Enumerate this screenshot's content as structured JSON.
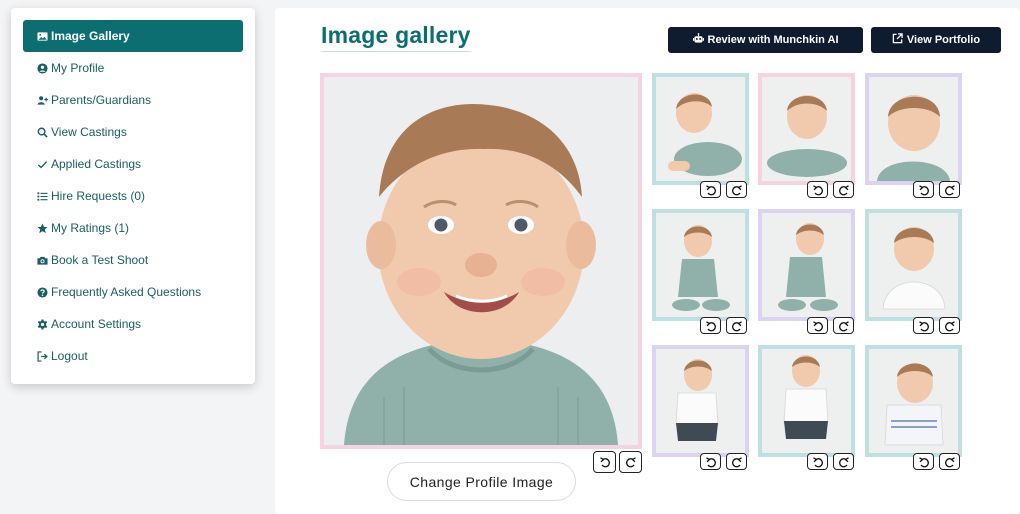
{
  "sidebar": {
    "items": [
      {
        "label": "Image Gallery",
        "icon": "image-icon",
        "active": true
      },
      {
        "label": "My Profile",
        "icon": "user-circle-icon"
      },
      {
        "label": "Parents/Guardians",
        "icon": "user-plus-icon"
      },
      {
        "label": "View Castings",
        "icon": "search-icon"
      },
      {
        "label": "Applied Castings",
        "icon": "check-icon"
      },
      {
        "label": "Hire Requests (0)",
        "icon": "list-icon"
      },
      {
        "label": "My Ratings (1)",
        "icon": "star-icon"
      },
      {
        "label": "Book a Test Shoot",
        "icon": "camera-icon"
      },
      {
        "label": "Frequently Asked Questions",
        "icon": "question-circle-icon"
      },
      {
        "label": "Account Settings",
        "icon": "gear-icon"
      },
      {
        "label": "Logout",
        "icon": "logout-icon"
      }
    ]
  },
  "main": {
    "title": "Image gallery",
    "review_button": "Review with Munchkin AI",
    "portfolio_button": "View Portfolio",
    "change_profile_button": "Change Profile Image"
  },
  "colors": {
    "primary": "#0d6e72",
    "dark_button": "#0f1b2e",
    "frame_teal": "#bfe0e2",
    "frame_pink": "#f5d3e0",
    "frame_lavender": "#dcd3f3"
  }
}
